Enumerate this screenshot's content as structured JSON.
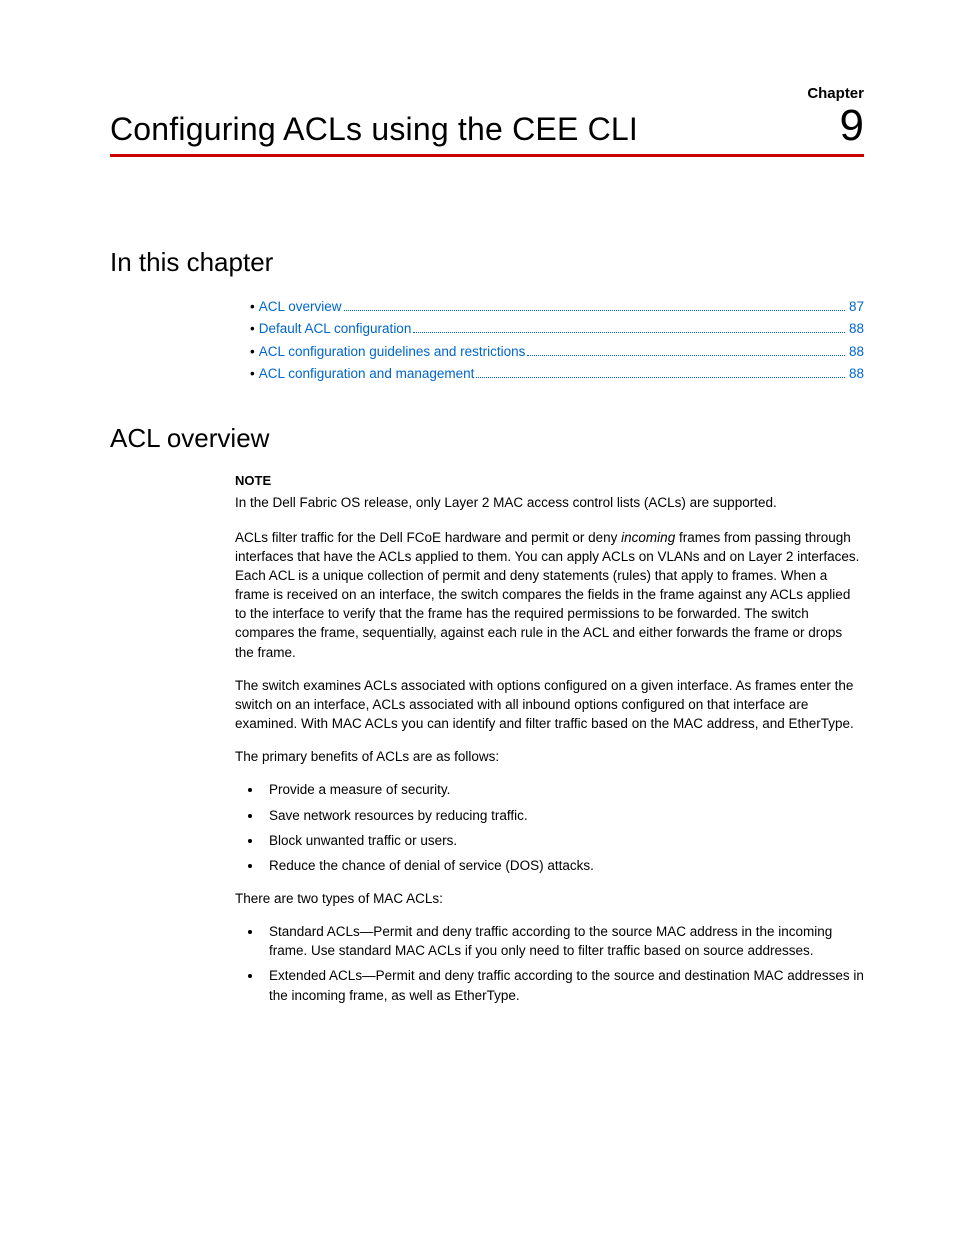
{
  "header": {
    "chapter_label": "Chapter",
    "title": "Configuring ACLs using the CEE CLI",
    "number": "9"
  },
  "sections": {
    "in_this_chapter": "In this chapter",
    "acl_overview": "ACL overview"
  },
  "toc": [
    {
      "label": "ACL overview",
      "page": "87"
    },
    {
      "label": "Default ACL configuration",
      "page": "88"
    },
    {
      "label": "ACL configuration guidelines and restrictions",
      "page": "88"
    },
    {
      "label": "ACL configuration and management",
      "page": "88"
    }
  ],
  "note": {
    "label": "NOTE",
    "text": "In the Dell Fabric OS release, only Layer 2 MAC access control lists (ACLs) are supported."
  },
  "paragraphs": {
    "p1_a": "ACLs filter traffic for the Dell FCoE hardware and permit or deny ",
    "p1_em": "incoming",
    "p1_b": " frames from passing through interfaces that have the ACLs applied to them. You can apply ACLs on VLANs and on Layer 2 interfaces. Each ACL is a unique collection of permit and deny statements (rules) that apply to frames. When a frame is received on an interface, the switch compares the fields in the frame against any ACLs applied to the interface to verify that the frame has the required permissions to be forwarded. The switch compares the frame, sequentially, against each rule in the ACL and either forwards the frame or drops the frame.",
    "p2": "The switch examines ACLs associated with options configured on a given interface. As frames enter the switch on an interface, ACLs associated with all inbound options configured on that interface are examined. With MAC ACLs you can identify and filter traffic based on the MAC address, and EtherType.",
    "p3": "The primary benefits of ACLs are as follows:",
    "p4": "There are two types of MAC ACLs:"
  },
  "benefits": [
    "Provide a measure of security.",
    "Save network resources by reducing traffic.",
    "Block unwanted traffic or users.",
    "Reduce the chance of denial of service (DOS) attacks."
  ],
  "types": [
    "Standard ACLs—Permit and deny traffic according to the source MAC address in the incoming frame. Use standard MAC ACLs if you only need to filter traffic based on source addresses.",
    "Extended ACLs—Permit and deny traffic according to the source and destination MAC addresses in the incoming frame, as well as EtherType."
  ]
}
